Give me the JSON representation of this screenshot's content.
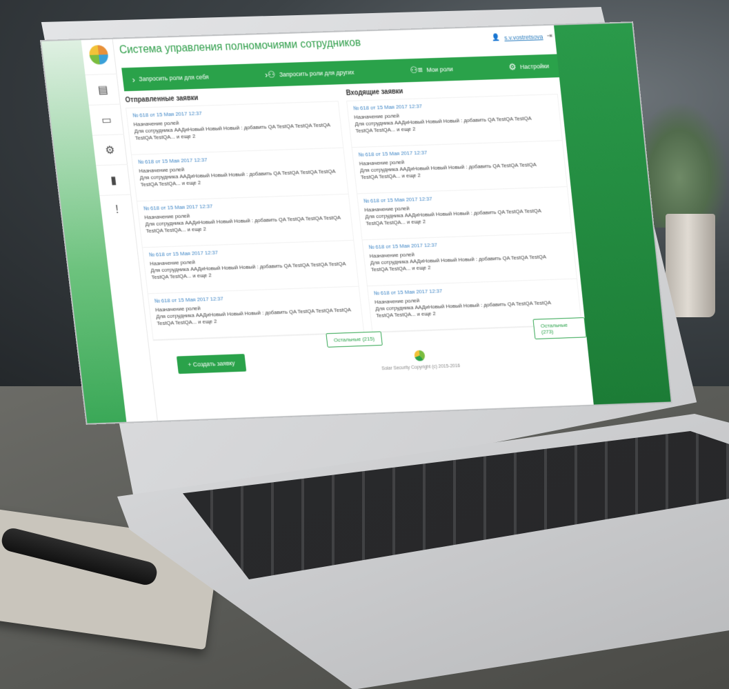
{
  "app": {
    "title": "Система управления полномочиями сотрудников",
    "user": {
      "name": "s.v.vostretsova"
    }
  },
  "sidebar": {
    "items": [
      {
        "icon": "documents-icon"
      },
      {
        "icon": "monitor-icon"
      },
      {
        "icon": "gear-icon"
      },
      {
        "icon": "bar-chart-icon"
      },
      {
        "icon": "alert-message-icon"
      }
    ]
  },
  "topnav": {
    "items": [
      {
        "label": "Запросить роли для себя",
        "icon": "chevron-right-icon"
      },
      {
        "label": "Запросить роли для других",
        "icon": "users-icon"
      },
      {
        "label": "Мои роли",
        "icon": "user-list-icon"
      },
      {
        "label": "Настройки",
        "icon": "gear-icon"
      }
    ]
  },
  "sent": {
    "heading": "Отправленные заявки",
    "items": [
      {
        "ref": "№ 618 от 15 Мая 2017 12:37",
        "title": "Назначение ролей",
        "line": "Для сотрудника ААДиНовый Новый Новый : добавить QA TestQA TestQA TestQA",
        "more": "TestQA TestQA... и еще 2"
      },
      {
        "ref": "№ 618 от 15 Мая 2017 12:37",
        "title": "Назначение ролей",
        "line": "Для сотрудника ААДиНовый Новый Новый : добавить QA TestQA TestQA TestQA",
        "more": "TestQA TestQA... и еще 2"
      },
      {
        "ref": "№ 618 от 15 Мая 2017 12:37",
        "title": "Назначение ролей",
        "line": "Для сотрудника ААДиНовый Новый Новый : добавить QA TestQA TestQA TestQA",
        "more": "TestQA TestQA... и еще 2"
      },
      {
        "ref": "№ 618 от 15 Мая 2017 12:37",
        "title": "Назначение ролей",
        "line": "Для сотрудника ААДиНовый Новый Новый : добавить QA TestQA TestQA TestQA",
        "more": "TestQA TestQA... и еще 2"
      },
      {
        "ref": "№ 618 от 15 Мая 2017 12:37",
        "title": "Назначение ролей",
        "line": "Для сотрудника ААДиНовый Новый Новый : добавить QA TestQA TestQA TestQA",
        "more": "TestQA TestQA... и еще 2"
      }
    ],
    "more_button": "Остальные (215)",
    "create_button": "+ Создать заявку"
  },
  "incoming": {
    "heading": "Входящие заявки",
    "items": [
      {
        "ref": "№ 618 от 15 Мая 2017 12:37",
        "title": "Назначение ролей",
        "line": "Для сотрудника ААДиНовый Новый Новый : добавить QA TestQA TestQA",
        "more": "TestQA TestQA... и еще 2"
      },
      {
        "ref": "№ 618 от 15 Мая 2017 12:37",
        "title": "Назначение ролей",
        "line": "Для сотрудника ААДиНовый Новый Новый : добавить QA TestQA TestQA",
        "more": "TestQA TestQA... и еще 2"
      },
      {
        "ref": "№ 618 от 15 Мая 2017 12:37",
        "title": "Назначение ролей",
        "line": "Для сотрудника ААДиНовый Новый Новый : добавить QA TestQA TestQA",
        "more": "TestQA TestQA... и еще 2"
      },
      {
        "ref": "№ 618 от 15 Мая 2017 12:37",
        "title": "Назначение ролей",
        "line": "Для сотрудника ААДиНовый Новый Новый : добавить QA TestQA TestQA",
        "more": "TestQA TestQA... и еще 2"
      },
      {
        "ref": "№ 618 от 15 Мая 2017 12:37",
        "title": "Назначение ролей",
        "line": "Для сотрудника ААДиНовый Новый Новый : добавить QA TestQA TestQA",
        "more": "TestQA TestQA... и еще 2"
      }
    ],
    "more_button": "Остальные (273)"
  },
  "footer": {
    "copyright": "Solar Security Copyright (c) 2015-2016"
  },
  "colors": {
    "accent": "#2aa24a",
    "link": "#3f86c6"
  }
}
